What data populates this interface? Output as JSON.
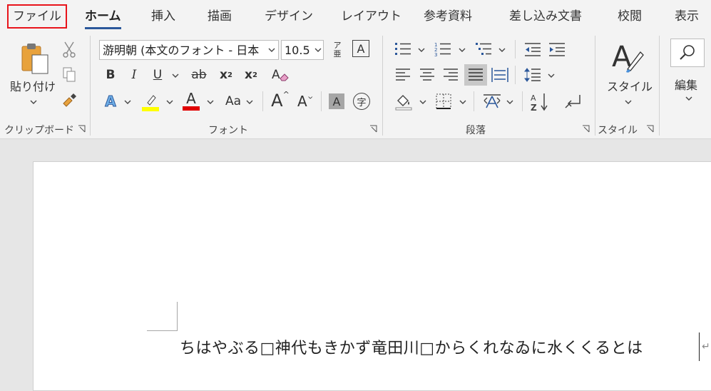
{
  "tabs": [
    {
      "label": "ファイル"
    },
    {
      "label": "ホーム"
    },
    {
      "label": "挿入"
    },
    {
      "label": "描画"
    },
    {
      "label": "デザイン"
    },
    {
      "label": "レイアウト"
    },
    {
      "label": "参考資料"
    },
    {
      "label": "差し込み文書"
    },
    {
      "label": "校閲"
    },
    {
      "label": "表示"
    }
  ],
  "clipboard": {
    "paste_label": "貼り付け",
    "group_label": "クリップボード"
  },
  "font": {
    "font_name": "游明朝 (本文のフォント - 日本",
    "font_size": "10.5",
    "furigana_top": "ア",
    "furigana_bottom": "亜",
    "border_char": "A",
    "bold": "B",
    "italic": "I",
    "underline": "U",
    "strike": "ab",
    "sub": "x",
    "sub_mark": "2",
    "sup": "x",
    "sup_mark": "2",
    "effects": "A",
    "font_color": "A",
    "case": "Aa",
    "grow": "A",
    "shrink": "A",
    "shade_char": "A",
    "enclose_char": "字",
    "group_label": "フォント"
  },
  "paragraph": {
    "group_label": "段落",
    "sort_label": "Z"
  },
  "styles": {
    "label": "スタイル",
    "group_label": "スタイル"
  },
  "editing": {
    "label": "編集"
  },
  "document": {
    "text": "ちはやぶる□神代もきかず竜田川□からくれなゐに水くくるとは",
    "para_mark": "↵"
  },
  "colors": {
    "accent": "#2b579a",
    "file_highlight": "#e8141b",
    "highlight_yellow": "#ffff00",
    "font_red": "#e00000"
  }
}
